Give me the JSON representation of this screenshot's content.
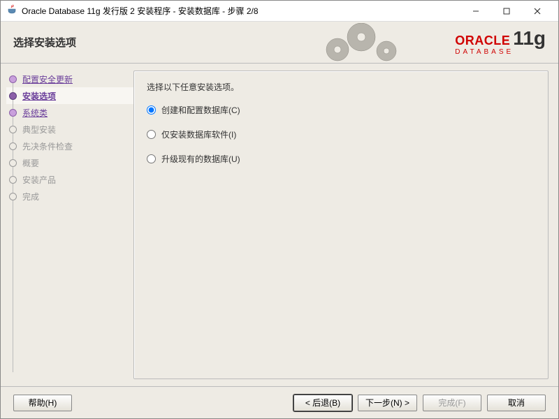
{
  "window": {
    "title": "Oracle Database 11g 发行版 2 安装程序 - 安装数据库 - 步骤 2/8"
  },
  "header": {
    "title": "选择安装选项",
    "logo_main": "ORACLE",
    "logo_ver": "11g",
    "logo_sub": "DATABASE"
  },
  "steps": [
    {
      "label": "配置安全更新",
      "state": "done"
    },
    {
      "label": "安装选项",
      "state": "active"
    },
    {
      "label": "系统类",
      "state": "done"
    },
    {
      "label": "典型安装",
      "state": "pending"
    },
    {
      "label": "先决条件检查",
      "state": "pending"
    },
    {
      "label": "概要",
      "state": "pending"
    },
    {
      "label": "安装产品",
      "state": "pending"
    },
    {
      "label": "完成",
      "state": "pending"
    }
  ],
  "main": {
    "prompt": "选择以下任意安装选项。",
    "options": [
      {
        "label": "创建和配置数据库(C)",
        "checked": true
      },
      {
        "label": "仅安装数据库软件(I)",
        "checked": false
      },
      {
        "label": "升级现有的数据库(U)",
        "checked": false
      }
    ]
  },
  "footer": {
    "help": "帮助(H)",
    "back": "< 后退(B)",
    "next": "下一步(N) >",
    "finish": "完成(F)",
    "cancel": "取消"
  }
}
